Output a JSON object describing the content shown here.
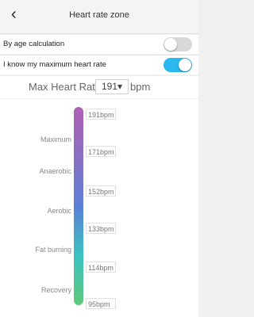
{
  "header": {
    "back_icon": "chevron-left-icon",
    "title": "Heart rate zone"
  },
  "settings": {
    "by_age": {
      "label": "By age calculation",
      "on": false
    },
    "know_max": {
      "label": "I know my maximum heart rate",
      "on": true
    }
  },
  "max_heart_rate": {
    "label": "Max Heart Rate",
    "value": "191",
    "unit": "bpm"
  },
  "zones": [
    {
      "name": "Maximum",
      "color": "#b05fb5"
    },
    {
      "name": "Anaerobic",
      "color": "#8a70c4"
    },
    {
      "name": "Aerobic",
      "color": "#5b7fd6"
    },
    {
      "name": "Fat burning",
      "color": "#3cc3c0"
    },
    {
      "name": "Recovery",
      "color": "#5fc879"
    }
  ],
  "bpm_marks": [
    "191bpm",
    "171bpm",
    "152bpm",
    "133bpm",
    "114bpm",
    "95bpm"
  ],
  "colors": {
    "toggle_on": "#2ab8ef",
    "toggle_off": "#d8d8d8"
  }
}
